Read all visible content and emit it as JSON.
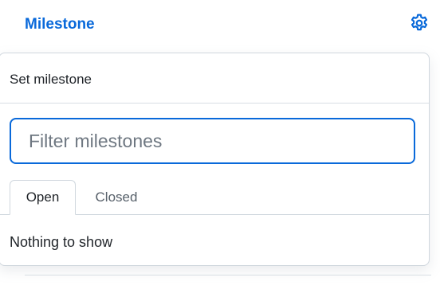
{
  "sidebar_section": {
    "title": "Milestone",
    "settings_icon": "gear-icon"
  },
  "popover": {
    "title": "Set milestone",
    "filter": {
      "value": "",
      "placeholder": "Filter milestones"
    },
    "tabs": [
      {
        "label": "Open",
        "selected": true
      },
      {
        "label": "Closed",
        "selected": false
      }
    ],
    "empty_message": "Nothing to show"
  },
  "colors": {
    "accent": "#0969da",
    "border": "#d0d7de",
    "text": "#1f2328",
    "muted": "#57606a"
  }
}
